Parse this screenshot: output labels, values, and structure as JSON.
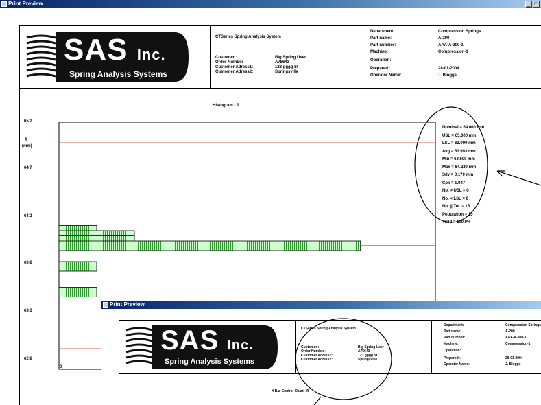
{
  "window1": {
    "title": "Print Preview",
    "controls": {
      "min_label": "_",
      "max_label": "□"
    }
  },
  "header": {
    "logo": {
      "big": "SAS",
      "inc": "Inc.",
      "subtitle": "Spring Analysis Systems"
    },
    "system_title": "CTSeries Spring Analysis System",
    "customer": {
      "labels": [
        "Customer :",
        "Order Number :",
        "Customer Adress1:",
        "Customer Adress2:"
      ],
      "values": [
        "Big Spring User",
        "A75643",
        "123 gggg St",
        "Springsville"
      ]
    },
    "info": {
      "labels": [
        "Department:",
        "Part name:",
        "Part number:",
        "Machine:",
        "Operation:",
        "Prepared :",
        "Operator Name:"
      ],
      "values": [
        "Compression Springs",
        "A-200",
        "AAA-A-300-1",
        "Compression-1",
        "",
        "28-01-2004",
        "J. Bloggs"
      ]
    }
  },
  "chart_data": {
    "type": "bar",
    "orientation": "horizontal",
    "title": "Histogram - fl",
    "ylabel": "fl (mm)",
    "ylabel_lines": [
      "fl",
      "(mm)"
    ],
    "y_ticks": [
      "65.2",
      "64.7",
      "64.2",
      "63.8",
      "63.3",
      "62.8"
    ],
    "x_tick": "0",
    "ylim": [
      62.8,
      65.2
    ],
    "usl": 65.0,
    "lsl": 63.0,
    "nominal": 64.0,
    "bins": [
      {
        "y": 64.15,
        "value": 1
      },
      {
        "y": 64.1,
        "value": 2
      },
      {
        "y": 64.05,
        "value": 2
      },
      {
        "y": 64.0,
        "value": 8
      },
      {
        "y": 63.8,
        "value": 1
      },
      {
        "y": 63.55,
        "value": 1
      }
    ],
    "stats": [
      "Nominal = 64.000 mm",
      "USL = 65.000 mm",
      "LSL = 63.000 mm",
      "Avg = 63.993 mm",
      "Min = 63.500 mm",
      "Max = 64.220 mm",
      "Sdv = 0.170 mm",
      "Cpk = 1.947",
      "No. > USL = 0",
      "No. < LSL = 0",
      "No. || Tol. = 15",
      "Population = 15",
      "Yield = 100.0%"
    ],
    "colors": {
      "bar_fill": "#ccffcc",
      "bar_stripe": "#339933",
      "limit_line": "#e06060",
      "nominal_line": "#3333aa"
    }
  },
  "window2": {
    "title": "Print Preview",
    "chart_title": "X Bar Control Chart - fl"
  }
}
